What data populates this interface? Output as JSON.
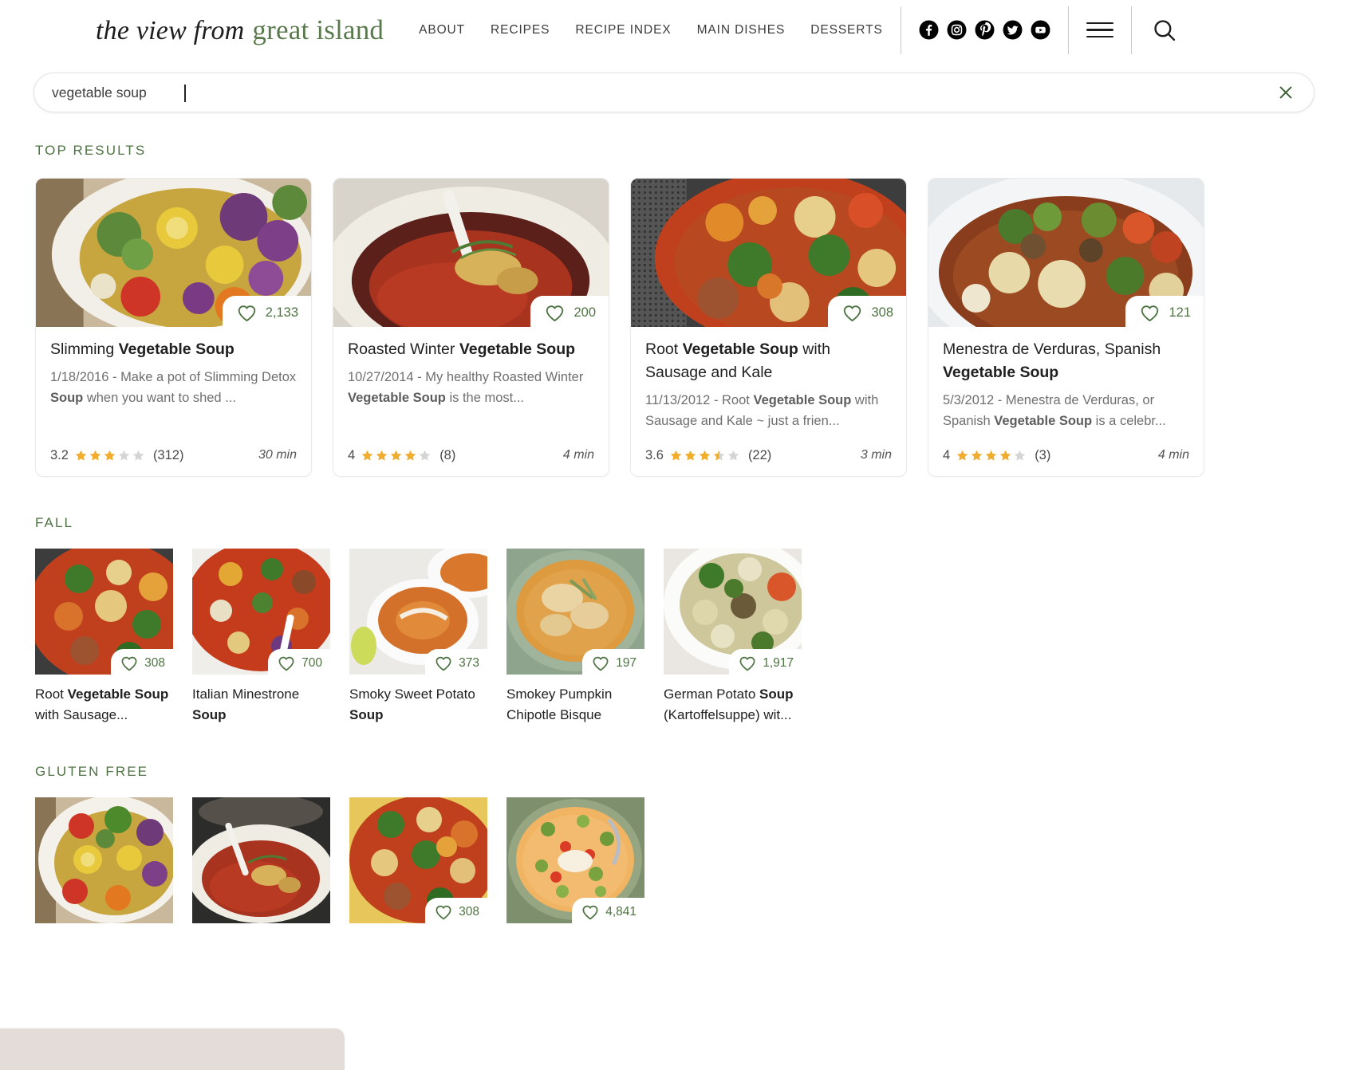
{
  "site": {
    "logo_part1": "the view from",
    "logo_part2": "great island",
    "accent_green": "#4e7342",
    "heart_green": "#4e7342",
    "star_gold": "#f0ad2e"
  },
  "nav": {
    "items": [
      {
        "label": "ABOUT"
      },
      {
        "label": "RECIPES"
      },
      {
        "label": "RECIPE INDEX"
      },
      {
        "label": "MAIN DISHES"
      },
      {
        "label": "DESSERTS"
      }
    ],
    "socials": [
      "facebook-icon",
      "instagram-icon",
      "pinterest-icon",
      "twitter-icon",
      "youtube-icon"
    ],
    "menu_icon": "hamburger-menu-icon",
    "search_icon": "search-icon"
  },
  "search": {
    "value": "vegetable soup",
    "placeholder": "Search",
    "clear_icon": "close-icon"
  },
  "sections": {
    "top_results": {
      "label": "TOP RESULTS"
    },
    "fall": {
      "label": "FALL"
    },
    "gluten_free": {
      "label": "GLUTEN FREE"
    }
  },
  "top_results": [
    {
      "title_pre": "Slimming ",
      "title_bold": "Vegetable Soup",
      "title_post": "",
      "snippet_pre": "1/18/2016 - Make a pot of Slimming Detox ",
      "snippet_bold": "Soup",
      "snippet_post": " when you want to shed ...",
      "favorites": "2,133",
      "rating": "3.2",
      "stars_filled": 3,
      "stars_half": 0,
      "review_count": "(312)",
      "time": "30 min"
    },
    {
      "title_pre": "Roasted Winter ",
      "title_bold": "Vegetable Soup",
      "title_post": "",
      "snippet_pre": "10/27/2014 - My healthy Roasted Winter ",
      "snippet_bold": "Vegetable Soup",
      "snippet_post": " is the most...",
      "favorites": "200",
      "rating": "4",
      "stars_filled": 4,
      "stars_half": 0,
      "review_count": "(8)",
      "time": "4 min"
    },
    {
      "title_pre": "Root ",
      "title_bold": "Vegetable Soup",
      "title_post": " with Sausage and Kale",
      "snippet_pre": "11/13/2012 - Root ",
      "snippet_bold": "Vegetable Soup",
      "snippet_post": " with Sausage and Kale ~ just a frien...",
      "favorites": "308",
      "rating": "3.6",
      "stars_filled": 3,
      "stars_half": 1,
      "review_count": "(22)",
      "time": "3 min"
    },
    {
      "title_pre": "Menestra de Verduras, Spanish ",
      "title_bold": "Vegetable Soup",
      "title_post": "",
      "snippet_pre": "5/3/2012 - Menestra de Verduras, or Spanish ",
      "snippet_bold": "Vegetable Soup",
      "snippet_post": " is a celebr...",
      "favorites": "121",
      "rating": "4",
      "stars_filled": 4,
      "stars_half": 0,
      "review_count": "(3)",
      "time": "4 min"
    }
  ],
  "fall_items": [
    {
      "title_pre": "Root ",
      "title_bold": "Vegetable Soup",
      "title_post": " with Sausage...",
      "favorites": "308"
    },
    {
      "title_pre": "Italian Minestrone ",
      "title_bold": "Soup",
      "title_post": "",
      "favorites": "700"
    },
    {
      "title_pre": "Smoky Sweet Potato ",
      "title_bold": "Soup",
      "title_post": "",
      "favorites": "373"
    },
    {
      "title_pre": "Smokey Pumpkin Chipotle Bisque",
      "title_bold": "",
      "title_post": "",
      "favorites": "197"
    },
    {
      "title_pre": "German Potato ",
      "title_bold": "Soup",
      "title_post": " (Kartoffelsuppe) wit...",
      "favorites": "1,917"
    }
  ],
  "gluten_free_items": [
    {
      "favorites": ""
    },
    {
      "favorites": ""
    },
    {
      "favorites": "308"
    },
    {
      "favorites": "4,841"
    }
  ]
}
